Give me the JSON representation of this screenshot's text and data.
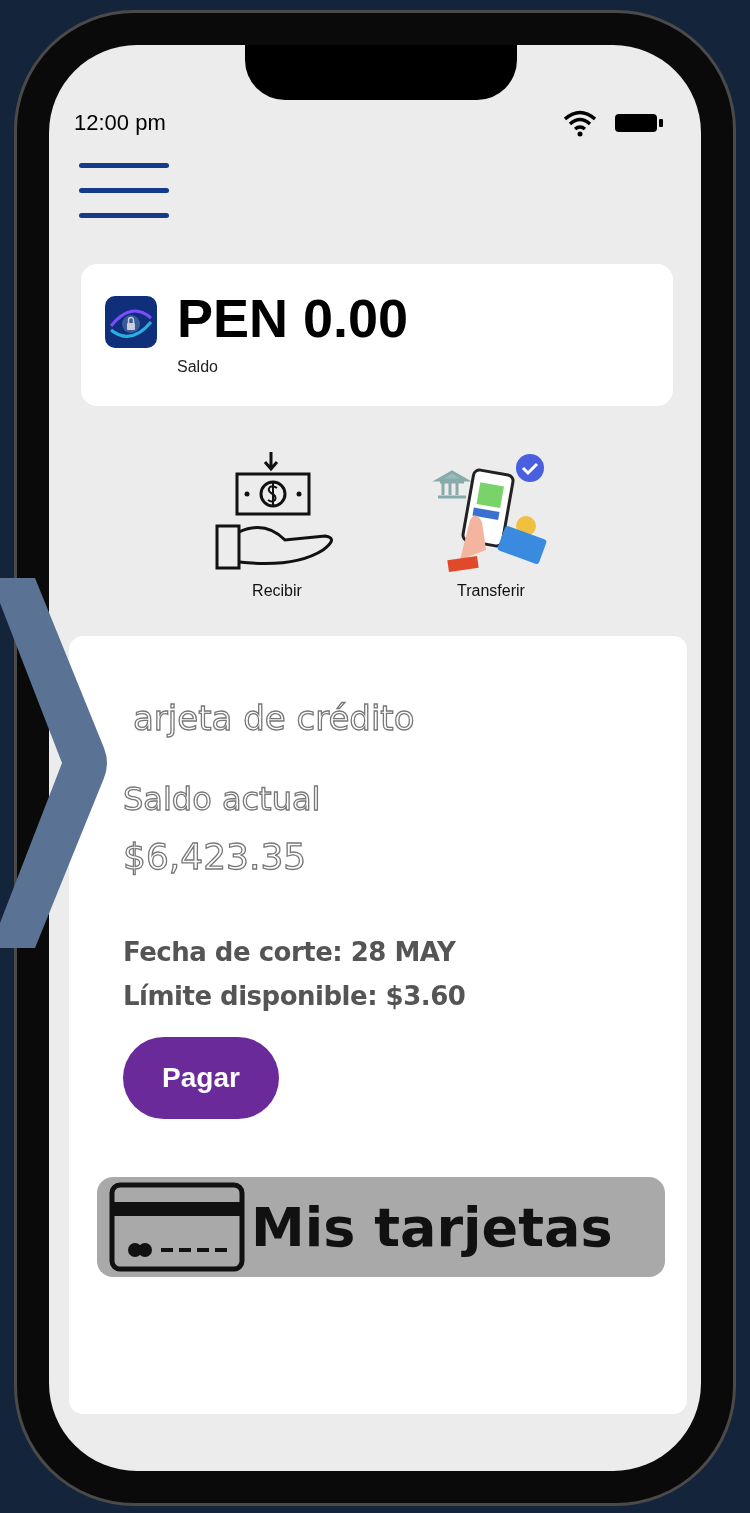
{
  "status_bar": {
    "time": "12:00 pm"
  },
  "balance": {
    "amount": "PEN 0.00",
    "label": "Saldo"
  },
  "actions": [
    {
      "kind": "receive",
      "label": "Recibir"
    },
    {
      "kind": "transfer",
      "label": "Transferir"
    }
  ],
  "credit_card": {
    "title": "arjeta de crédito",
    "balance_label": "Saldo actual",
    "balance": "$6,423.35",
    "cut_date": "Fecha de corte: 28 MAY",
    "available_limit": "Límite disponible: $3.60",
    "pay_button": "Pagar"
  },
  "cards_button": {
    "label": "Mis tarjetas"
  }
}
